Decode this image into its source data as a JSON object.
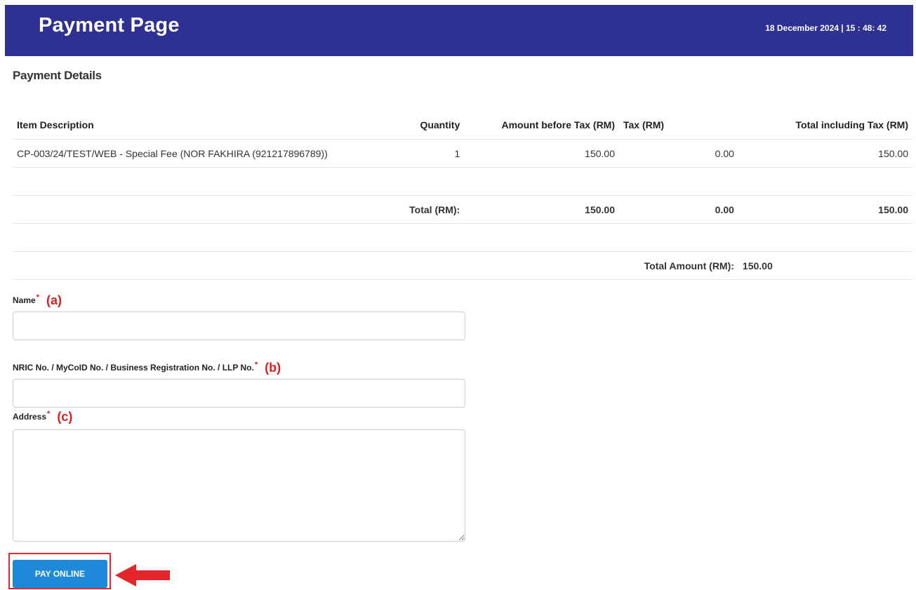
{
  "header": {
    "title": "Payment Page",
    "datetime": "18 December 2024 | 15 : 48: 42",
    "bg_color": "#2e3192"
  },
  "section_title": "Payment Details",
  "table": {
    "headers": {
      "description": "Item Description",
      "quantity": "Quantity",
      "amount_before_tax": "Amount before Tax (RM)",
      "tax": "Tax (RM)",
      "total_including_tax": "Total including Tax (RM)"
    },
    "rows": [
      {
        "description": "CP-003/24/TEST/WEB - Special Fee (NOR FAKHIRA (921217896789))",
        "quantity": "1",
        "amount_before_tax": "150.00",
        "tax": "0.00",
        "total_including_tax": "150.00"
      }
    ],
    "totals": {
      "label": "Total (RM):",
      "amount_before_tax": "150.00",
      "tax": "0.00",
      "total_including_tax": "150.00"
    },
    "grand_total": {
      "label": "Total Amount (RM):",
      "value": "150.00"
    }
  },
  "form": {
    "name": {
      "label": "Name",
      "required_mark": "*",
      "annotation": "(a)",
      "value": ""
    },
    "id_no": {
      "label": "NRIC No. / MyCoID No. / Business Registration No. / LLP No.",
      "required_mark": "*",
      "annotation": "(b)",
      "value": ""
    },
    "address": {
      "label": "Address",
      "required_mark": "*",
      "annotation": "(c)",
      "value": ""
    }
  },
  "pay_button": {
    "label": "PAY ONLINE",
    "color": "#1e88d9"
  },
  "highlight_color": "#e3262b",
  "arrow_icon": "left-arrow-icon"
}
